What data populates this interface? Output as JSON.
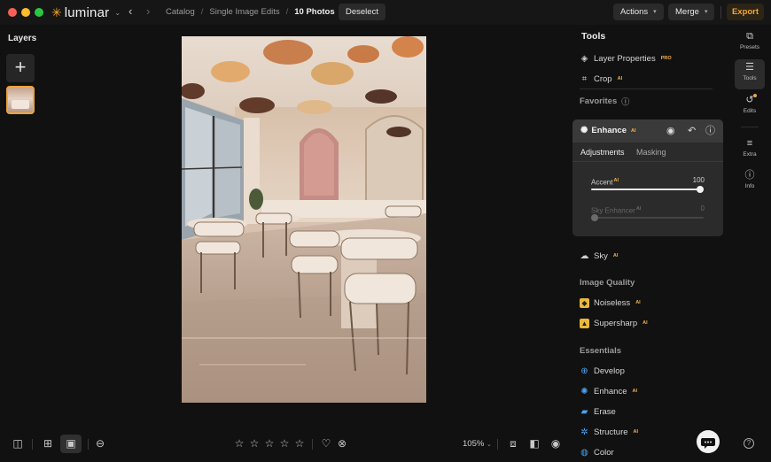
{
  "app": {
    "name": "luminar"
  },
  "breadcrumbs": [
    {
      "label": "Catalog"
    },
    {
      "label": "Single Image Edits"
    },
    {
      "label": "10 Photos"
    }
  ],
  "header": {
    "deselect_label": "Deselect",
    "actions_label": "Actions",
    "merge_label": "Merge",
    "export_label": "Export",
    "accent_color": "#f0a63a"
  },
  "layers": {
    "title": "Layers"
  },
  "bottom_bar": {
    "zoom": "105%"
  },
  "tools_panel": {
    "title": "Tools",
    "layer_properties": "Layer Properties",
    "layer_properties_badge": "PRO",
    "crop": "Crop",
    "ai_badge": "AI",
    "favorites_label": "Favorites",
    "enhance_card": {
      "title": "Enhance",
      "tab_adjustments": "Adjustments",
      "tab_masking": "Masking",
      "sliders": [
        {
          "label": "Accent",
          "value": "100",
          "level": 1.0,
          "enabled": true
        },
        {
          "label": "Sky Enhancer",
          "value": "0",
          "level": 0.0,
          "enabled": false
        }
      ]
    },
    "sky": "Sky",
    "image_quality_label": "Image Quality",
    "noiseless": "Noiseless",
    "supersharp": "Supersharp",
    "essentials_label": "Essentials",
    "develop": "Develop",
    "enhance": "Enhance",
    "erase": "Erase",
    "structure": "Structure",
    "color": "Color"
  },
  "rail": {
    "presets": "Presets",
    "tools": "Tools",
    "edits": "Edits",
    "extra": "Extra",
    "info": "Info"
  }
}
